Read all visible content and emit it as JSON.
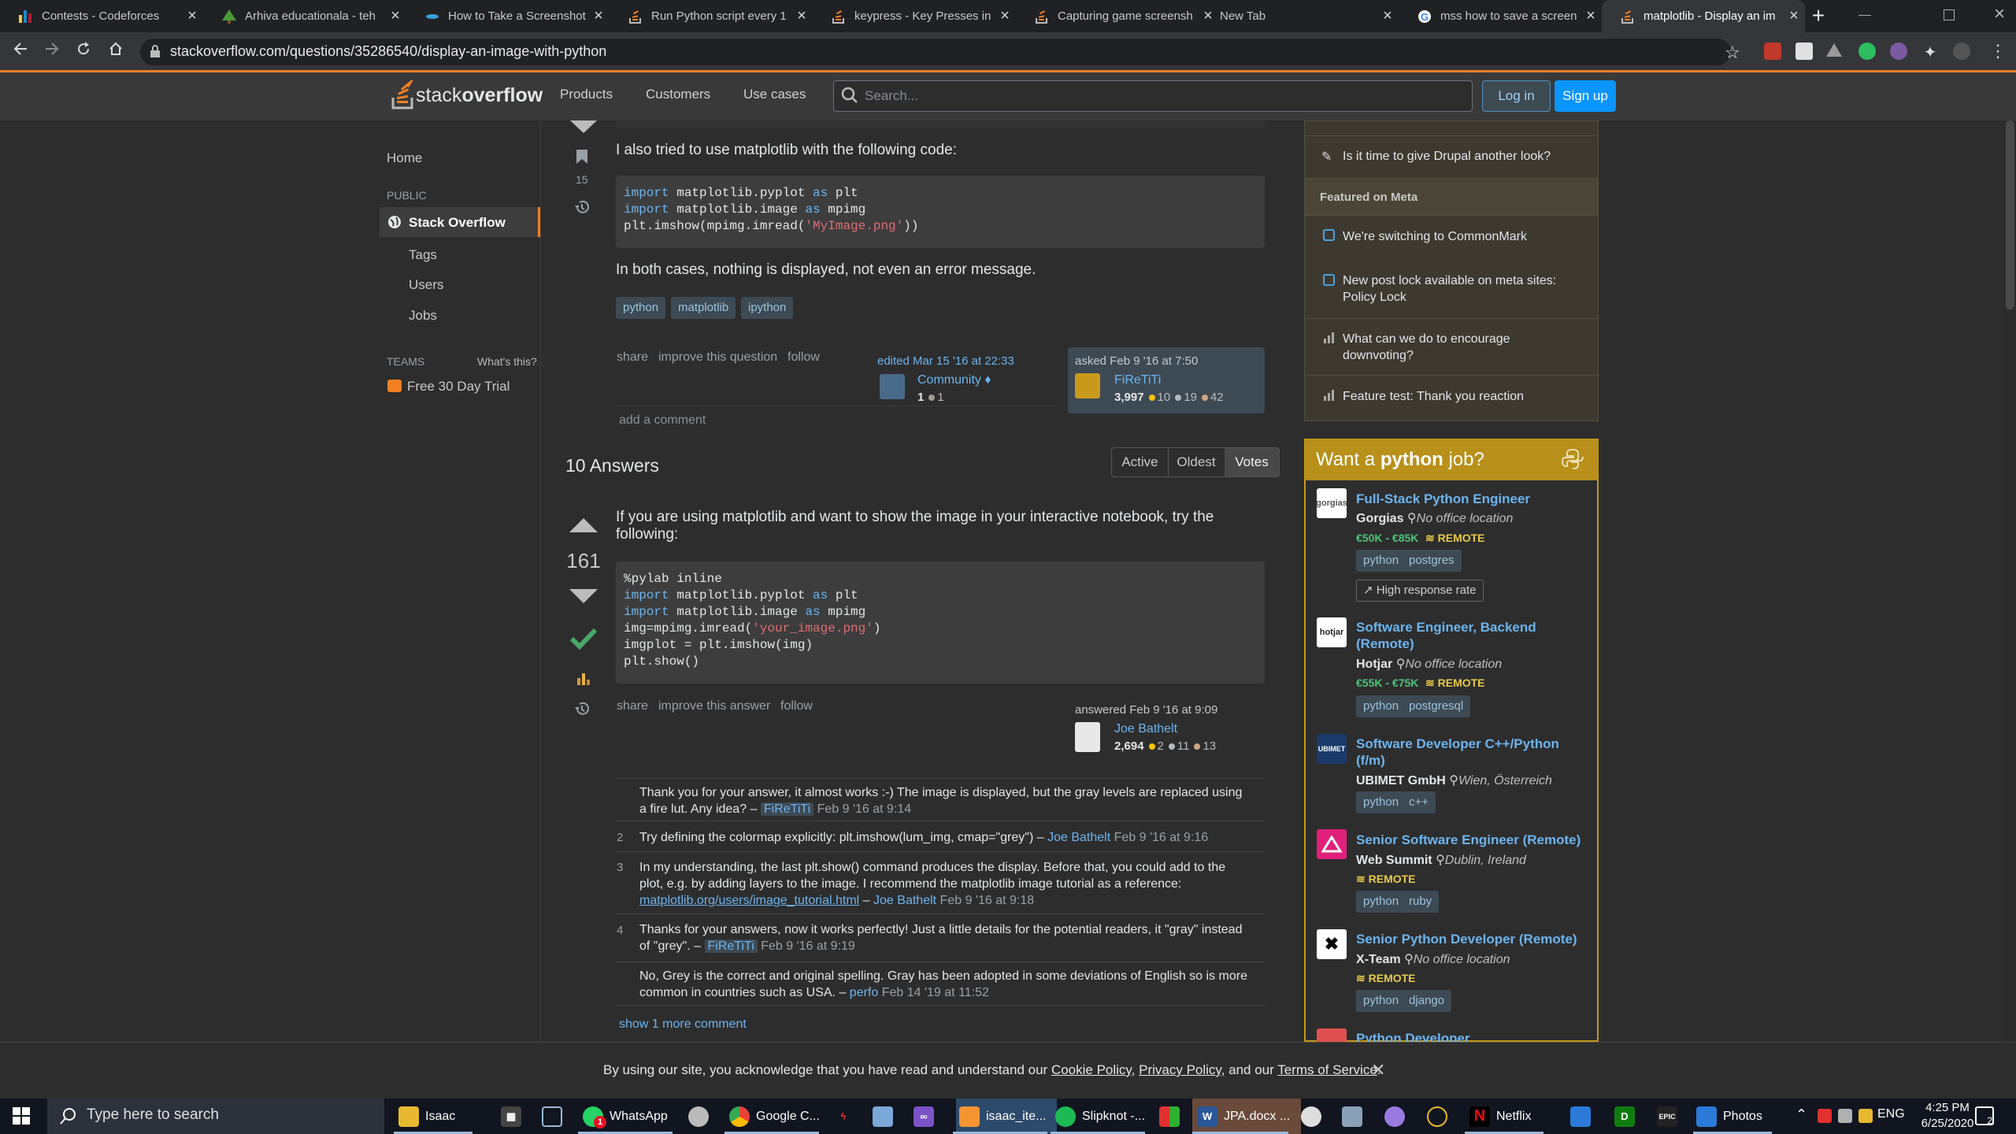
{
  "browser": {
    "tabs": [
      {
        "title": "Contests - Codeforces"
      },
      {
        "title": "Arhiva educationala - teh"
      },
      {
        "title": "How to Take a Screenshot"
      },
      {
        "title": "Run Python script every 1"
      },
      {
        "title": "keypress - Key Presses in"
      },
      {
        "title": "Capturing game screensh"
      },
      {
        "title": "New Tab"
      },
      {
        "title": "mss how to save a screen"
      },
      {
        "title": "matplotlib - Display an im"
      }
    ],
    "url": "stackoverflow.com/questions/35286540/display-an-image-with-python",
    "new_tab": "+"
  },
  "header": {
    "logo_light": "stack",
    "logo_bold": "overflow",
    "nav": [
      "Products",
      "Customers",
      "Use cases"
    ],
    "search_placeholder": "Search...",
    "login": "Log in",
    "signup": "Sign up"
  },
  "leftnav": {
    "home": "Home",
    "public_heading": "PUBLIC",
    "stack_overflow": "Stack Overflow",
    "tags": "Tags",
    "users": "Users",
    "jobs": "Jobs",
    "teams_heading": "TEAMS",
    "whats_this": "What's this?",
    "free_trial": "Free 30 Day Trial"
  },
  "question": {
    "bookmark_count": "15",
    "para1": "I also tried to use matplotlib with the following code:",
    "code_lines": [
      "import matplotlib.pyplot as plt",
      "import matplotlib.image as mpimg",
      "plt.imshow(mpimg.imread('MyImage.png'))"
    ],
    "para2": "In both cases, nothing is displayed, not even an error message.",
    "tags": [
      "python",
      "matplotlib",
      "ipython"
    ],
    "actions": [
      "share",
      "improve this question",
      "follow"
    ],
    "edited": "edited Mar 15 '16 at 22:33",
    "editor": "Community",
    "editor_diamond": "♦",
    "editor_rep": "1",
    "editor_badge": "1",
    "asked": "asked Feb 9 '16 at 7:50",
    "asker": "FiReTiTi",
    "asker_rep": "3,997",
    "asker_gold": "10",
    "asker_silver": "19",
    "asker_bronze": "42",
    "add_comment": "add a comment"
  },
  "answers": {
    "count_label": "10 Answers",
    "sort": [
      "Active",
      "Oldest",
      "Votes"
    ],
    "score": "161",
    "text": "If you are using matplotlib and want to show the image in your interactive notebook, try the following:",
    "code_lines": [
      "%pylab inline",
      "import matplotlib.pyplot as plt",
      "import matplotlib.image as mpimg",
      "img=mpimg.imread('your_image.png')",
      "imgplot = plt.imshow(img)",
      "plt.show()"
    ],
    "actions": [
      "share",
      "improve this answer",
      "follow"
    ],
    "answered": "answered Feb 9 '16 at 9:09",
    "author": "Joe Bathelt",
    "author_rep": "2,694",
    "author_gold": "2",
    "author_silver": "11",
    "author_bronze": "13",
    "comments": [
      {
        "score": "",
        "l1": "Thank you for your answer, it almost works :-) The image is displayed, but the gray levels are replaced using",
        "l2": "a fire lut. Any idea? –",
        "user": "FiReTiTi",
        "date": "Feb 9 '16 at 9:14"
      },
      {
        "score": "2",
        "l1": "Try defining the colormap explicitly: plt.imshow(lum_img, cmap=\"grey\") –",
        "user": "Joe Bathelt",
        "date": "Feb 9 '16 at 9:16"
      },
      {
        "score": "3",
        "l1": "In my understanding, the last plt.show() command produces the display. Before that, you could add to the",
        "l2": "plot, e.g. by adding layers to the image. I recommend the matplotlib image tutorial as a reference:",
        "link": "matplotlib.org/users/image_tutorial.html",
        "user": "Joe Bathelt",
        "date": "Feb 9 '16 at 9:18"
      },
      {
        "score": "4",
        "l1": "Thanks for your answers, now it works perfectly! Just a little details for the potential readers, it \"gray\" instead",
        "l2": "of \"grey\". –",
        "user": "FiReTiTi",
        "date": "Feb 9 '16 at 9:19"
      },
      {
        "score": "",
        "l1": "No, Grey is the correct and original spelling. Gray has been adopted in some deviations of English so is more",
        "l2": "common in countries such as USA. –",
        "user": "perfo",
        "date": "Feb 14 '19 at 11:52"
      }
    ],
    "show_more": "show 1 more comment"
  },
  "sidebar": {
    "drupal": "Is it time to give Drupal another look?",
    "featured_heading": "Featured on Meta",
    "meta": [
      {
        "l1": "We're switching to CommonMark",
        "l2": ""
      },
      {
        "l1": "New post lock available on meta sites:",
        "l2": "Policy Lock"
      },
      {
        "l1": "What can we do to encourage",
        "l2": "downvoting?"
      },
      {
        "l1": "Feature test: Thank you reaction",
        "l2": ""
      }
    ]
  },
  "jobs": {
    "heading_pre": "Want a ",
    "heading_bold": "python",
    "heading_post": " job?",
    "listings": [
      {
        "title": "Full-Stack Python Engineer",
        "company": "Gorgias",
        "location": "No office location",
        "salary": "€50K - €85K",
        "remote": "REMOTE",
        "tags": [
          "python",
          "postgres"
        ],
        "extra": "High response rate",
        "logo": "gorgias"
      },
      {
        "title1": "Software Engineer, Backend",
        "title2": "(Remote)",
        "company": "Hotjar",
        "location": "No office location",
        "salary": "€55K - €75K",
        "remote": "REMOTE",
        "tags": [
          "python",
          "postgresql"
        ],
        "logo": "hotjar"
      },
      {
        "title1": "Software Developer C++/Python",
        "title2": "(f/m)",
        "company": "UBIMET GmbH",
        "location": "Wien, Österreich",
        "tags": [
          "python",
          "c++"
        ],
        "logo": "UBIMET"
      },
      {
        "title": "Senior Software Engineer (Remote)",
        "company": "Web Summit",
        "location": "Dublin, Ireland",
        "remote": "REMOTE",
        "tags": [
          "python",
          "ruby"
        ]
      },
      {
        "title": "Senior Python Developer (Remote)",
        "company": "X-Team",
        "location": "No office location",
        "remote": "REMOTE",
        "tags": [
          "python",
          "django"
        ]
      },
      {
        "title": "Python Developer"
      }
    ]
  },
  "cookie": {
    "pre": "By using our site, you acknowledge that you have read and understand our ",
    "l1": "Cookie Policy",
    "sep1": ", ",
    "l2": "Privacy Policy",
    "sep2": ", and our ",
    "l3": "Terms of Service",
    "end": ".",
    "close": "✕"
  },
  "taskbar": {
    "search_placeholder": "Type here to search",
    "apps": [
      {
        "label": "Isaac"
      },
      {
        "label": "WhatsApp",
        "badge": "1"
      },
      {
        "label": "Google C..."
      },
      {
        "label": "isaac_ite..."
      },
      {
        "label": "Slipknot -..."
      },
      {
        "label": "JPA.docx ..."
      },
      {
        "label": "Netflix"
      },
      {
        "label": "Photos"
      }
    ],
    "lang": "ENG",
    "time": "4:25 PM",
    "date": "6/25/2020",
    "notif_count": "2"
  },
  "colors": {
    "so_orange": "#f48024",
    "link_blue": "#6cb4f0",
    "signup_blue": "#0a95ff",
    "accept_green": "#48a868",
    "jobs_gold": "#b8901a"
  }
}
